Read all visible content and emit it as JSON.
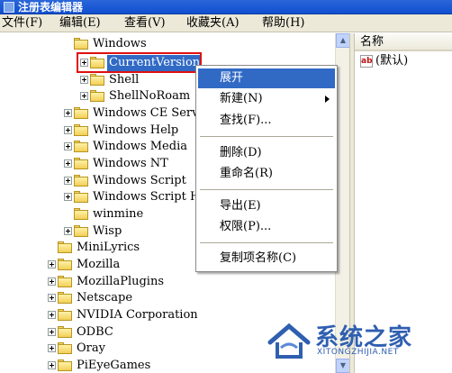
{
  "window": {
    "title": "注册表编辑器"
  },
  "menubar": {
    "items": [
      {
        "label": "文件(F)"
      },
      {
        "label": "编辑(E)"
      },
      {
        "label": "查看(V)"
      },
      {
        "label": "收藏夹(A)"
      },
      {
        "label": "帮助(H)"
      }
    ]
  },
  "tree": {
    "windows": {
      "label": "Windows"
    },
    "currentversion": {
      "label": "CurrentVersion"
    },
    "shell": {
      "label": "Shell"
    },
    "shellnoroam": {
      "label": "ShellNoRoam"
    },
    "wince": {
      "label": "Windows CE Services"
    },
    "winhelp": {
      "label": "Windows Help"
    },
    "winmedia": {
      "label": "Windows Media"
    },
    "winnt": {
      "label": "Windows NT"
    },
    "winscript": {
      "label": "Windows Script"
    },
    "winscripthost": {
      "label": "Windows Script Host"
    },
    "winmine": {
      "label": "winmine"
    },
    "wisp": {
      "label": "Wisp"
    },
    "minilyrics": {
      "label": "MiniLyrics"
    },
    "mozilla": {
      "label": "Mozilla"
    },
    "mozillaplugins": {
      "label": "MozillaPlugins"
    },
    "netscape": {
      "label": "Netscape"
    },
    "nvidia": {
      "label": "NVIDIA Corporation"
    },
    "odbc": {
      "label": "ODBC"
    },
    "oray": {
      "label": "Oray"
    },
    "pieyegames": {
      "label": "PiEyeGames"
    }
  },
  "list": {
    "column_name": "名称",
    "default_value": "(默认)",
    "icon": "ab-string-value-icon"
  },
  "context_menu": {
    "expand": "展开",
    "new": "新建(N)",
    "find": "查找(F)...",
    "delete": "删除(D)",
    "rename": "重命名(R)",
    "export": "导出(E)",
    "permissions": "权限(P)...",
    "copy_key_name": "复制项名称(C)"
  },
  "watermark": {
    "brand": "系统之家",
    "url": "XITONGZHIJIA.NET"
  },
  "colors": {
    "selection": "#316ac5",
    "highlight_box": "#e01010",
    "titlebar": "#0f4fd0"
  }
}
